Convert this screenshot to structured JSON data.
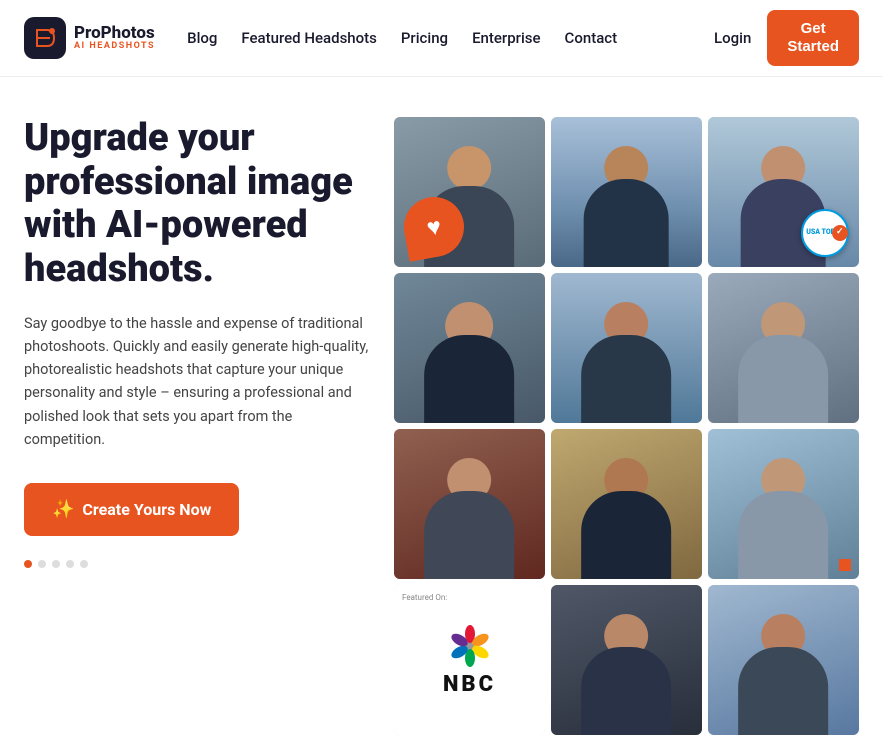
{
  "header": {
    "logo_main": "ProPhotos",
    "logo_sub": "AI HEADSHOTS",
    "nav": [
      {
        "label": "Blog",
        "href": "#"
      },
      {
        "label": "Featured Headshots",
        "href": "#"
      },
      {
        "label": "Pricing",
        "href": "#"
      },
      {
        "label": "Enterprise",
        "href": "#"
      },
      {
        "label": "Contact",
        "href": "#"
      }
    ],
    "login_label": "Login",
    "get_started_label": "Get\nStarted"
  },
  "hero": {
    "title": "Upgrade your professional image with AI-powered headshots.",
    "description": "Say goodbye to the hassle and expense of traditional photoshoots. Quickly and easily generate high-quality, photorealistic headshots that capture your unique personality and style – ensuring a professional and polished look that sets you apart from the competition.",
    "cta_label": "Create Yours Now"
  },
  "photos": [
    {
      "id": 1,
      "bg": "gray",
      "has_heart": true
    },
    {
      "id": 2,
      "bg": "city"
    },
    {
      "id": 3,
      "bg": "city2",
      "has_usa_today": true
    },
    {
      "id": 4,
      "bg": "blue"
    },
    {
      "id": 5,
      "bg": "city"
    },
    {
      "id": 6,
      "bg": "light"
    },
    {
      "id": 7,
      "bg": "warm"
    },
    {
      "id": 8,
      "bg": "brown"
    },
    {
      "id": 9,
      "bg": "light"
    },
    {
      "id": 10,
      "bg": "nbc",
      "is_nbc": true
    },
    {
      "id": 11,
      "bg": "dark"
    },
    {
      "id": 12,
      "bg": "city2"
    }
  ],
  "nbc": {
    "featured_on": "Featured On:",
    "logo_text": "NBC"
  },
  "usa_today": {
    "text": "USA TODAY"
  }
}
